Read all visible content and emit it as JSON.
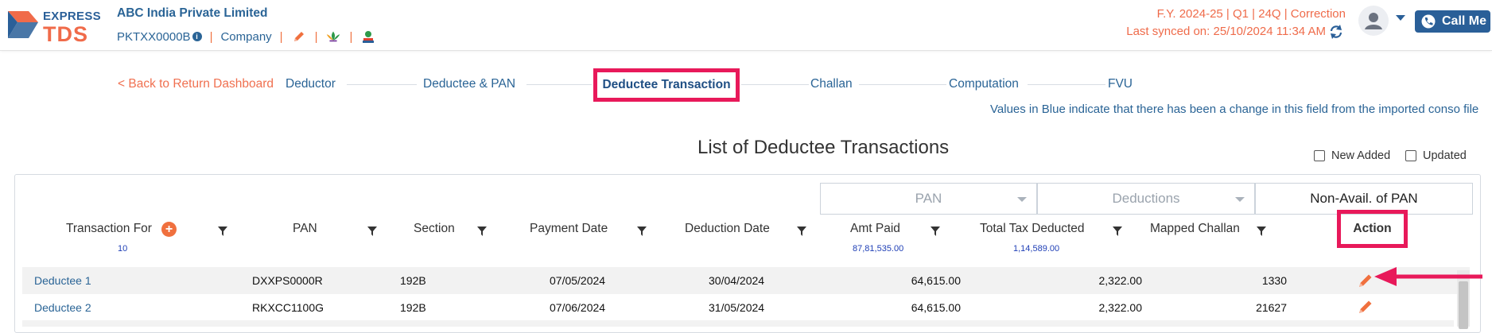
{
  "header": {
    "logo_top": "EXPRESS",
    "logo_bottom": "TDS",
    "company": "ABC India Private Limited",
    "pan": "PKTXX0000B",
    "info_mark": "i",
    "entity": "Company",
    "separator": "|",
    "fy_line": "F.Y. 2024-25  | Q1  | 24Q | Correction",
    "sync_line": "Last synced on: 25/10/2024 11:34 AM",
    "call_label": "Call Me",
    "colors": {
      "primary": "#2a5f98",
      "accent": "#f0703e",
      "highlight": "#e8195a"
    }
  },
  "steps": {
    "back": "< Back to Return Dashboard",
    "deductor": "Deductor",
    "deductee_pan": "Deductee & PAN",
    "deductee_transaction": "Deductee Transaction",
    "challan": "Challan",
    "computation": "Computation",
    "fvu": "FVU"
  },
  "note": "Values in Blue indicate that there has been a change in this field from the imported conso file",
  "list_title": "List of Deductee Transactions",
  "checkboxes": {
    "new_added": "New Added",
    "updated": "Updated"
  },
  "filters": {
    "pan": "PAN",
    "deductions": "Deductions",
    "non_avail": "Non-Avail. of PAN"
  },
  "table": {
    "headers": {
      "transaction_for": "Transaction For",
      "pan": "PAN",
      "section": "Section",
      "payment_date": "Payment Date",
      "deduction_date": "Deduction Date",
      "amt_paid": "Amt Paid",
      "total_tax": "Total Tax Deducted",
      "mapped_challan": "Mapped Challan",
      "action": "Action"
    },
    "add_symbol": "+",
    "subtotals": {
      "count": "10",
      "amt_paid": "87,81,535.00",
      "total_tax": "1,14,589.00"
    },
    "rows": [
      {
        "name": "Deductee 1",
        "pan": "DXXPS0000R",
        "section": "192B",
        "payment_date": "07/05/2024",
        "deduction_date": "30/04/2024",
        "amt_paid": "64,615.00",
        "tax": "2,322.00",
        "challan": "1330"
      },
      {
        "name": "Deductee 2",
        "pan": "RKXCC1100G",
        "section": "192B",
        "payment_date": "07/06/2024",
        "deduction_date": "31/05/2024",
        "amt_paid": "64,615.00",
        "tax": "2,322.00",
        "challan": "21627"
      }
    ]
  },
  "icons": [
    "logo-icon",
    "info-icon",
    "pencil-icon",
    "lotus-icon",
    "bank-icon",
    "refresh-icon",
    "user-icon",
    "phone-icon",
    "filter-icon",
    "edit-icon",
    "arrow-icon"
  ]
}
